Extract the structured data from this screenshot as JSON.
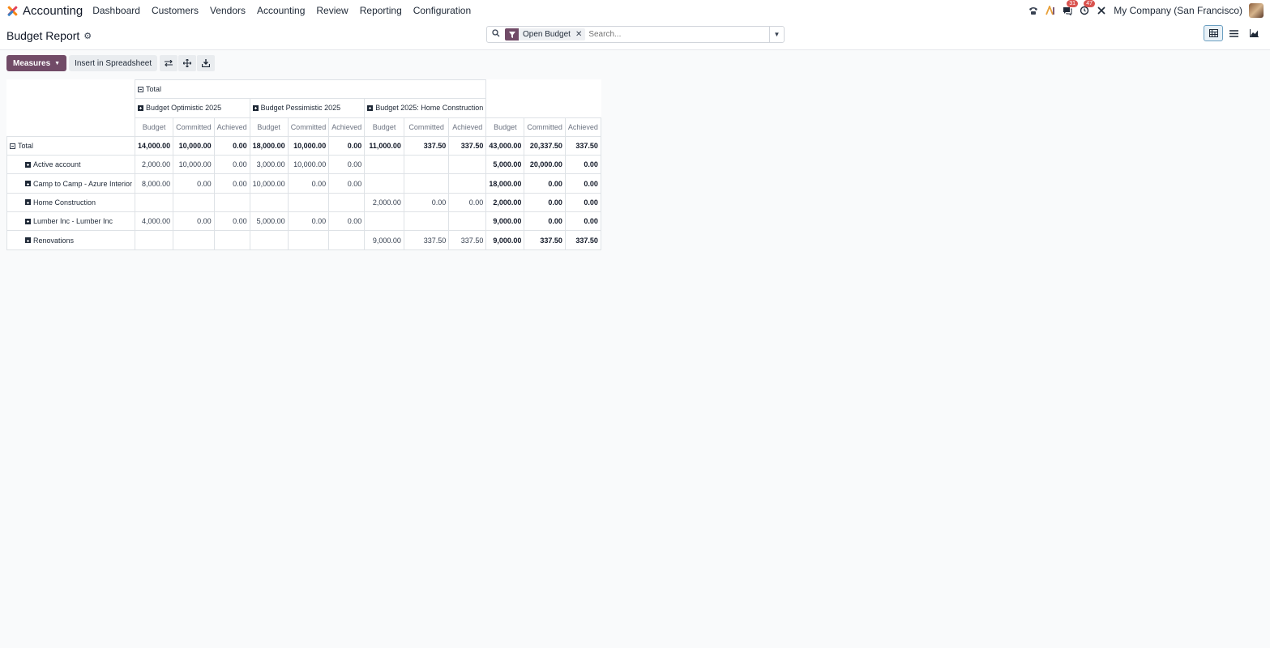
{
  "app": {
    "name": "Accounting"
  },
  "menu": [
    "Dashboard",
    "Customers",
    "Vendors",
    "Accounting",
    "Review",
    "Reporting",
    "Configuration"
  ],
  "systray": {
    "messages_count": "31",
    "activities_count": "47",
    "company": "My Company (San Francisco)"
  },
  "page": {
    "title": "Budget Report"
  },
  "search": {
    "facet": "Open Budget",
    "placeholder": "Search..."
  },
  "toolbar": {
    "measures_label": "Measures",
    "insert_label": "Insert in Spreadsheet"
  },
  "pivot": {
    "col_total_label": "Total",
    "col_groups": [
      "Budget Optimistic 2025",
      "Budget Pessimistic 2025",
      "Budget 2025: Home Construction"
    ],
    "measures": [
      "Budget",
      "Committed",
      "Achieved",
      "Budget",
      "Committed",
      "Achieved",
      "Budget",
      "Committed",
      "Achieved",
      "Budget",
      "Committed",
      "Achieved"
    ],
    "rows": [
      {
        "label": "Total",
        "values": [
          "14,000.00",
          "10,000.00",
          "0.00",
          "18,000.00",
          "10,000.00",
          "0.00",
          "11,000.00",
          "337.50",
          "337.50",
          "43,000.00",
          "20,337.50",
          "337.50"
        ]
      },
      {
        "label": "Active account",
        "values": [
          "2,000.00",
          "10,000.00",
          "0.00",
          "3,000.00",
          "10,000.00",
          "0.00",
          "",
          "",
          "",
          "5,000.00",
          "20,000.00",
          "0.00"
        ]
      },
      {
        "label": "Camp to Camp - Azure Interior",
        "values": [
          "8,000.00",
          "0.00",
          "0.00",
          "10,000.00",
          "0.00",
          "0.00",
          "",
          "",
          "",
          "18,000.00",
          "0.00",
          "0.00"
        ]
      },
      {
        "label": "Home Construction",
        "values": [
          "",
          "",
          "",
          "",
          "",
          "",
          "2,000.00",
          "0.00",
          "0.00",
          "2,000.00",
          "0.00",
          "0.00"
        ]
      },
      {
        "label": "Lumber Inc - Lumber Inc",
        "values": [
          "4,000.00",
          "0.00",
          "0.00",
          "5,000.00",
          "0.00",
          "0.00",
          "",
          "",
          "",
          "9,000.00",
          "0.00",
          "0.00"
        ]
      },
      {
        "label": "Renovations",
        "values": [
          "",
          "",
          "",
          "",
          "",
          "",
          "9,000.00",
          "337.50",
          "337.50",
          "9,000.00",
          "337.50",
          "337.50"
        ]
      }
    ]
  }
}
